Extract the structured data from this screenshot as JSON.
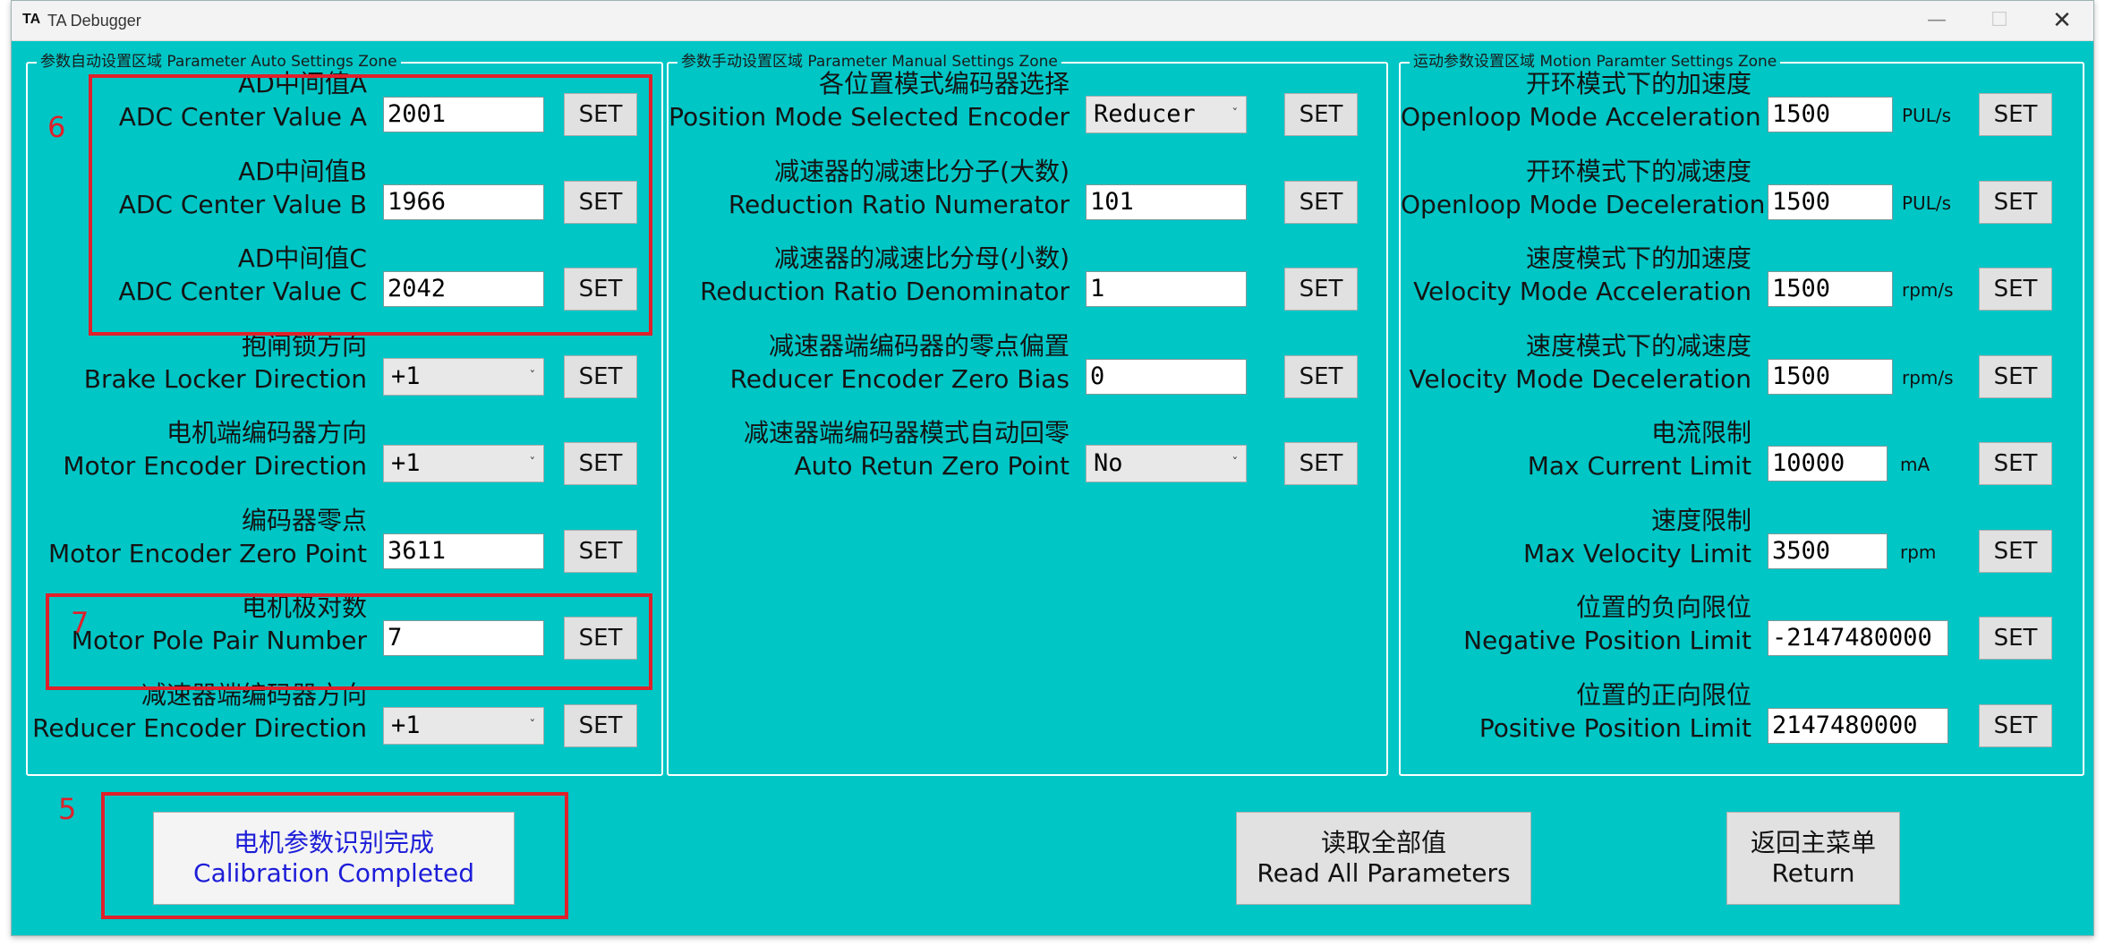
{
  "window": {
    "logo": "TA",
    "title": "TA Debugger",
    "min": "—",
    "max": "☐",
    "close": "✕"
  },
  "groups": {
    "auto": "参数自动设置区域 Parameter Auto Settings Zone",
    "manual": "参数手动设置区域 Parameter Manual Settings Zone",
    "motion": "运动参数设置区域 Motion Paramter Settings Zone"
  },
  "set_label": "SET",
  "auto": [
    {
      "cn": "AD中间值A",
      "en": "ADC Center Value A",
      "value": "2001",
      "kind": "text"
    },
    {
      "cn": "AD中间值B",
      "en": "ADC Center Value B",
      "value": "1966",
      "kind": "text"
    },
    {
      "cn": "AD中间值C",
      "en": "ADC Center Value C",
      "value": "2042",
      "kind": "text"
    },
    {
      "cn": "抱闸锁方向",
      "en": "Brake Locker Direction",
      "value": "+1",
      "kind": "combo"
    },
    {
      "cn": "电机端编码器方向",
      "en": "Motor Encoder Direction",
      "value": "+1",
      "kind": "combo"
    },
    {
      "cn": "编码器零点",
      "en": "Motor Encoder Zero Point",
      "value": "3611",
      "kind": "text"
    },
    {
      "cn": "电机极对数",
      "en": "Motor Pole Pair Number",
      "value": "7",
      "kind": "text"
    },
    {
      "cn": "减速器端编码器方向",
      "en": "Reducer Encoder Direction",
      "value": "+1",
      "kind": "combo"
    }
  ],
  "manual": [
    {
      "cn": "各位置模式编码器选择",
      "en": "Position Mode Selected Encoder",
      "value": "Reducer",
      "kind": "combo"
    },
    {
      "cn": "减速器的减速比分子(大数)",
      "en": "Reduction Ratio Numerator",
      "value": "101",
      "kind": "text"
    },
    {
      "cn": "减速器的减速比分母(小数)",
      "en": "Reduction Ratio Denominator",
      "value": "1",
      "kind": "text"
    },
    {
      "cn": "减速器端编码器的零点偏置",
      "en": "Reducer Encoder Zero Bias",
      "value": "0",
      "kind": "text"
    },
    {
      "cn": "减速器端编码器模式自动回零",
      "en": "Auto Retun Zero Point",
      "value": "No",
      "kind": "combo"
    }
  ],
  "motion": [
    {
      "cn": "开环模式下的加速度",
      "en": "Openloop Mode Acceleration",
      "value": "1500",
      "unit": "PUL/s"
    },
    {
      "cn": "开环模式下的减速度",
      "en": "Openloop Mode Deceleration",
      "value": "1500",
      "unit": "PUL/s"
    },
    {
      "cn": "速度模式下的加速度",
      "en": "Velocity Mode Acceleration",
      "value": "1500",
      "unit": "rpm/s"
    },
    {
      "cn": "速度模式下的减速度",
      "en": "Velocity Mode Deceleration",
      "value": "1500",
      "unit": "rpm/s"
    },
    {
      "cn": "电流限制",
      "en": "Max Current Limit",
      "value": "10000",
      "unit": "mA"
    },
    {
      "cn": "速度限制",
      "en": "Max Velocity Limit",
      "value": "3500",
      "unit": "rpm"
    },
    {
      "cn": "位置的负向限位",
      "en": "Negative Position Limit",
      "value": "-2147480000",
      "unit": ""
    },
    {
      "cn": "位置的正向限位",
      "en": "Positive Position Limit",
      "value": "2147480000",
      "unit": ""
    }
  ],
  "annotations": {
    "n5": "5",
    "n6": "6",
    "n7": "7"
  },
  "buttons": {
    "calib_cn": "电机参数识别完成",
    "calib_en": "Calibration Completed",
    "read_cn": "读取全部值",
    "read_en": "Read All Parameters",
    "return_cn": "返回主菜单",
    "return_en": "Return"
  },
  "colors": {
    "background": "#00c6c6",
    "highlight": "#e0202a",
    "calib_text": "#1d1dd8"
  }
}
